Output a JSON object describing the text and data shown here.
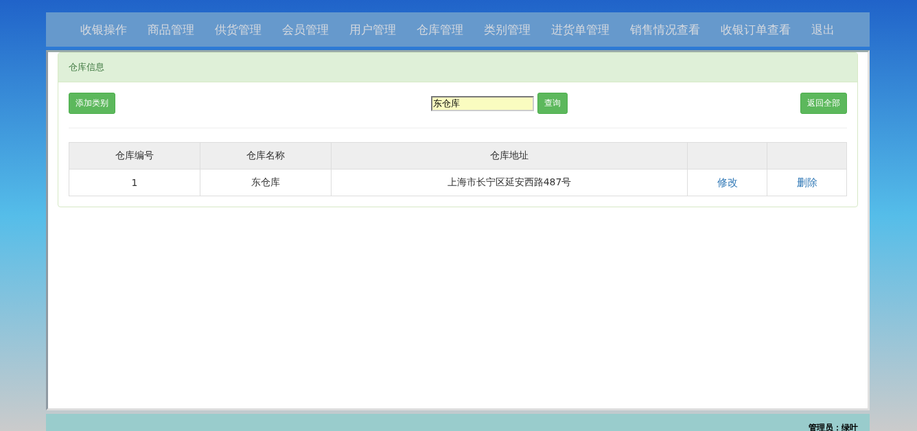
{
  "nav": {
    "items": [
      "收银操作",
      "商品管理",
      "供货管理",
      "会员管理",
      "用户管理",
      "仓库管理",
      "类别管理",
      "进货单管理",
      "销售情况查看",
      "收银订单查看",
      "退出"
    ]
  },
  "panel": {
    "title": "仓库信息",
    "add_button": "添加类别",
    "search": {
      "value": "东仓库"
    },
    "search_button": "查询",
    "reset_button": "返回全部"
  },
  "table": {
    "columns": [
      "仓库编号",
      "仓库名称",
      "仓库地址"
    ],
    "rows": [
      {
        "cells": [
          "1",
          "东仓库",
          "上海市长宁区延安西路487号"
        ],
        "actions": [
          "修改",
          "删除"
        ]
      }
    ]
  },
  "footer": {
    "user": "管理员：绿叶"
  }
}
